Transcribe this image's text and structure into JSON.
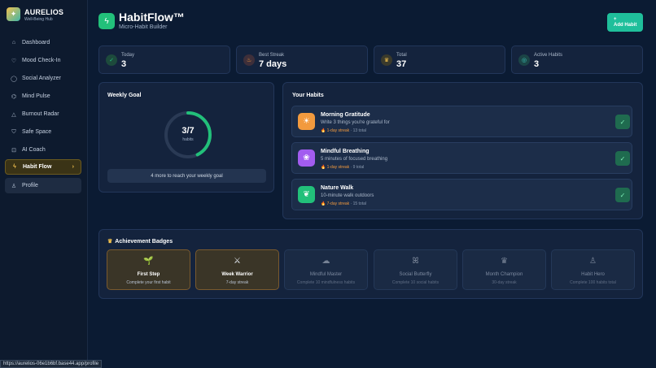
{
  "brand": {
    "name": "AURELIOS",
    "subtitle": "Well-Being Hub",
    "logo_icon": "sparkle-icon"
  },
  "nav": [
    {
      "label": "Dashboard",
      "icon": "home-icon",
      "glyph": "⌂"
    },
    {
      "label": "Mood Check-In",
      "icon": "heart-icon",
      "glyph": "♡"
    },
    {
      "label": "Social Analyzer",
      "icon": "chat-icon",
      "glyph": "◯"
    },
    {
      "label": "Mind Pulse",
      "icon": "brain-icon",
      "glyph": "⌬"
    },
    {
      "label": "Burnout Radar",
      "icon": "alert-icon",
      "glyph": "△"
    },
    {
      "label": "Safe Space",
      "icon": "shield-icon",
      "glyph": "⛉"
    },
    {
      "label": "AI Coach",
      "icon": "bot-icon",
      "glyph": "⊡"
    },
    {
      "label": "Habit Flow",
      "icon": "bolt-icon",
      "glyph": "ϟ",
      "active": true
    },
    {
      "label": "Profile",
      "icon": "user-icon",
      "glyph": "♙"
    }
  ],
  "status_url": "https://aurelios-06e1b6bf.base44.app/profile",
  "header": {
    "title": "HabitFlow™",
    "subtitle": "Micro-Habit Builder",
    "add_label_plus": "+",
    "add_label": "Add Habit"
  },
  "stats": [
    {
      "label": "Today",
      "value": "3",
      "icon": "check-icon",
      "glyph": "✓",
      "color": "#22c07a",
      "bg": "#1d4a3c"
    },
    {
      "label": "Best Streak",
      "value": "7 days",
      "icon": "flame-icon",
      "glyph": "♨",
      "color": "#f29a3e",
      "bg": "#3e2f3a"
    },
    {
      "label": "Total",
      "value": "37",
      "icon": "trophy-icon",
      "glyph": "♛",
      "color": "#f2c14e",
      "bg": "#3a3a2c"
    },
    {
      "label": "Active Habits",
      "value": "3",
      "icon": "target-icon",
      "glyph": "◎",
      "color": "#3fd0c0",
      "bg": "#1b4446"
    }
  ],
  "weekly": {
    "title": "Weekly Goal",
    "value": "3/7",
    "unit": "habits",
    "progress": 0.4286,
    "note": "4 more to reach your weekly goal"
  },
  "habits_title": "Your Habits",
  "habits": [
    {
      "name": "Morning Gratitude",
      "desc": "Write 3 things you're grateful for",
      "streak": "🔥 1-day streak",
      "total": "13 total",
      "icon": "sunrise-icon",
      "glyph": "☀",
      "color": "#f29a3e"
    },
    {
      "name": "Mindful Breathing",
      "desc": "5 minutes of focused breathing",
      "streak": "🔥 1-day streak",
      "total": "9 total",
      "icon": "meditation-icon",
      "glyph": "❀",
      "color": "#a25cf0"
    },
    {
      "name": "Nature Walk",
      "desc": "10-minute walk outdoors",
      "streak": "🔥 7-day streak",
      "total": "15 total",
      "icon": "leaf-icon",
      "glyph": "❦",
      "color": "#22c07a"
    }
  ],
  "badges_title": "Achievement Badges",
  "badges": [
    {
      "name": "First Step",
      "desc": "Complete your first habit",
      "icon": "seedling-icon",
      "glyph": "🌱",
      "unlocked": true
    },
    {
      "name": "Week Warrior",
      "desc": "7-day streak",
      "icon": "swords-icon",
      "glyph": "⚔",
      "unlocked": true
    },
    {
      "name": "Mindful Master",
      "desc": "Complete 10 mindfulness habits",
      "icon": "brain-icon",
      "glyph": "☁",
      "unlocked": false
    },
    {
      "name": "Social Butterfly",
      "desc": "Complete 10 social habits",
      "icon": "butterfly-icon",
      "glyph": "ꕤ",
      "unlocked": false
    },
    {
      "name": "Month Champion",
      "desc": "30-day streak",
      "icon": "trophy-icon",
      "glyph": "♛",
      "unlocked": false
    },
    {
      "name": "Habit Hero",
      "desc": "Complete 100 habits total",
      "icon": "hero-icon",
      "glyph": "♙",
      "unlocked": false
    }
  ]
}
